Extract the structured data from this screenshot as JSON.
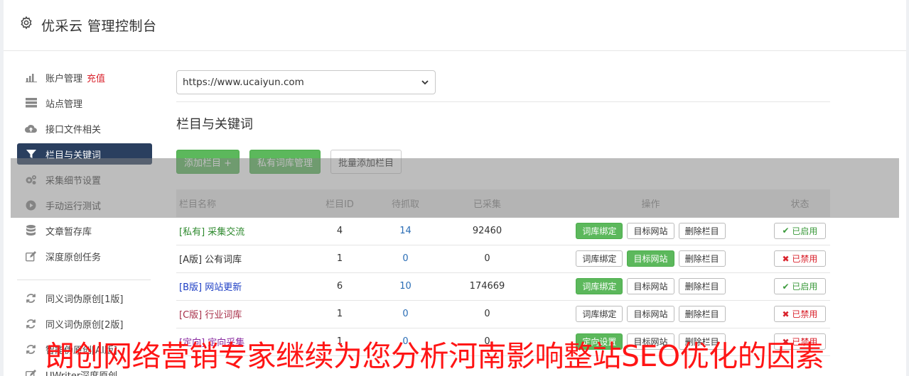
{
  "header": {
    "title": "优采云 管理控制台",
    "icon": "gear-icon"
  },
  "sidebar": {
    "items": [
      {
        "label": "账户管理",
        "badge": "充值",
        "icon": "bar-chart-icon"
      },
      {
        "label": "站点管理",
        "icon": "server-icon"
      },
      {
        "label": "接口文件相关",
        "icon": "cloud-upload-icon"
      },
      {
        "label": "栏目与关键词",
        "icon": "filter-icon",
        "active": true
      },
      {
        "label": "采集细节设置",
        "icon": "gears-icon"
      },
      {
        "label": "手动运行测试",
        "icon": "play-circle-icon"
      },
      {
        "label": "文章暂存库",
        "icon": "database-icon"
      },
      {
        "label": "深度原创任务",
        "icon": "edit-icon"
      }
    ],
    "items2": [
      {
        "label": "同义词伪原创[1版]",
        "icon": "refresh-icon"
      },
      {
        "label": "同义词伪原创[2版]",
        "icon": "refresh-icon"
      },
      {
        "label": "智能伪原创[AI版]",
        "icon": "refresh-icon"
      },
      {
        "label": "UWriter深度原创",
        "icon": "edit-icon"
      }
    ]
  },
  "main": {
    "site_select": "https://www.ucaiyun.com",
    "section_title": "栏目与关键词",
    "buttons": {
      "add_column": "添加栏目 +",
      "private_lib": "私有词库管理",
      "batch_add": "批量添加栏目"
    },
    "table": {
      "headers": [
        "栏目名称",
        "栏目ID",
        "待抓取",
        "已采集",
        "操作",
        "状态"
      ],
      "actions": {
        "bind": "词库绑定",
        "target": "目标网站",
        "delete": "删除栏目",
        "direct": "定向设置"
      },
      "status": {
        "on": "已启用",
        "off": "已禁用"
      },
      "rows": [
        {
          "name": "[私有] 采集交流",
          "id": "4",
          "pending": "14",
          "collected": "92460"
        },
        {
          "name": "[A版] 公有词库",
          "id": "1",
          "pending": "0",
          "collected": "0"
        },
        {
          "name": "[B版] 网站更新",
          "id": "6",
          "pending": "10",
          "collected": "174669"
        },
        {
          "name": "[C版] 行业词库",
          "id": "1",
          "pending": "0",
          "collected": "0"
        },
        {
          "name": "[定向] 定向采集",
          "id": "1",
          "pending": "0",
          "collected": "0"
        }
      ]
    }
  },
  "overlay": {
    "caption": "朗创网络营销专家继续为您分析河南影响整站SEO优化的因素"
  },
  "colors": {
    "accent_green": "#5cb85c",
    "active_nav": "#2a3f5f",
    "caption_red": "#ff1515"
  }
}
